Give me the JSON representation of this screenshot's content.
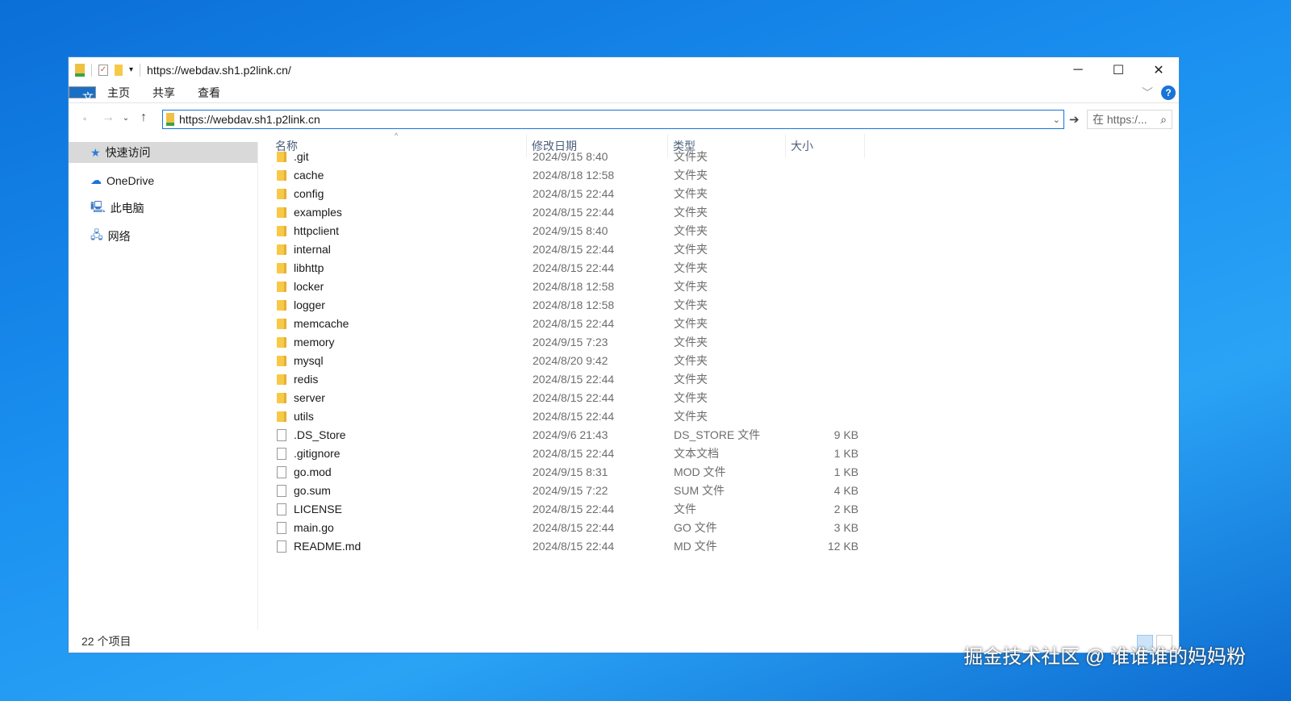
{
  "window": {
    "title": "https://webdav.sh1.p2link.cn/"
  },
  "ribbon": {
    "tabs": [
      "文件",
      "主页",
      "共享",
      "查看"
    ]
  },
  "address": {
    "value": "https://webdav.sh1.p2link.cn",
    "search_placeholder": "在 https:/..."
  },
  "sidebar": {
    "items": [
      {
        "label": "快速访问",
        "icon": "star-icon"
      },
      {
        "label": "OneDrive",
        "icon": "cloud-icon"
      },
      {
        "label": "此电脑",
        "icon": "computer-icon"
      },
      {
        "label": "网络",
        "icon": "network-icon"
      }
    ]
  },
  "columns": [
    "名称",
    "修改日期",
    "类型",
    "大小"
  ],
  "files": [
    {
      "name": ".git",
      "date": "2024/9/15 8:40",
      "type": "文件夹",
      "size": "",
      "kind": "folder"
    },
    {
      "name": "cache",
      "date": "2024/8/18 12:58",
      "type": "文件夹",
      "size": "",
      "kind": "folder"
    },
    {
      "name": "config",
      "date": "2024/8/15 22:44",
      "type": "文件夹",
      "size": "",
      "kind": "folder"
    },
    {
      "name": "examples",
      "date": "2024/8/15 22:44",
      "type": "文件夹",
      "size": "",
      "kind": "folder"
    },
    {
      "name": "httpclient",
      "date": "2024/9/15 8:40",
      "type": "文件夹",
      "size": "",
      "kind": "folder"
    },
    {
      "name": "internal",
      "date": "2024/8/15 22:44",
      "type": "文件夹",
      "size": "",
      "kind": "folder"
    },
    {
      "name": "libhttp",
      "date": "2024/8/15 22:44",
      "type": "文件夹",
      "size": "",
      "kind": "folder"
    },
    {
      "name": "locker",
      "date": "2024/8/18 12:58",
      "type": "文件夹",
      "size": "",
      "kind": "folder"
    },
    {
      "name": "logger",
      "date": "2024/8/18 12:58",
      "type": "文件夹",
      "size": "",
      "kind": "folder"
    },
    {
      "name": "memcache",
      "date": "2024/8/15 22:44",
      "type": "文件夹",
      "size": "",
      "kind": "folder"
    },
    {
      "name": "memory",
      "date": "2024/9/15 7:23",
      "type": "文件夹",
      "size": "",
      "kind": "folder"
    },
    {
      "name": "mysql",
      "date": "2024/8/20 9:42",
      "type": "文件夹",
      "size": "",
      "kind": "folder"
    },
    {
      "name": "redis",
      "date": "2024/8/15 22:44",
      "type": "文件夹",
      "size": "",
      "kind": "folder"
    },
    {
      "name": "server",
      "date": "2024/8/15 22:44",
      "type": "文件夹",
      "size": "",
      "kind": "folder"
    },
    {
      "name": "utils",
      "date": "2024/8/15 22:44",
      "type": "文件夹",
      "size": "",
      "kind": "folder"
    },
    {
      "name": ".DS_Store",
      "date": "2024/9/6 21:43",
      "type": "DS_STORE 文件",
      "size": "9 KB",
      "kind": "file"
    },
    {
      "name": ".gitignore",
      "date": "2024/8/15 22:44",
      "type": "文本文档",
      "size": "1 KB",
      "kind": "file"
    },
    {
      "name": "go.mod",
      "date": "2024/9/15 8:31",
      "type": "MOD 文件",
      "size": "1 KB",
      "kind": "file"
    },
    {
      "name": "go.sum",
      "date": "2024/9/15 7:22",
      "type": "SUM 文件",
      "size": "4 KB",
      "kind": "file"
    },
    {
      "name": "LICENSE",
      "date": "2024/8/15 22:44",
      "type": "文件",
      "size": "2 KB",
      "kind": "file"
    },
    {
      "name": "main.go",
      "date": "2024/8/15 22:44",
      "type": "GO 文件",
      "size": "3 KB",
      "kind": "file"
    },
    {
      "name": "README.md",
      "date": "2024/8/15 22:44",
      "type": "MD 文件",
      "size": "12 KB",
      "kind": "file"
    }
  ],
  "status": {
    "count": "22 个项目"
  },
  "watermark": "掘金技术社区 @ 谁谁谁的妈妈粉"
}
